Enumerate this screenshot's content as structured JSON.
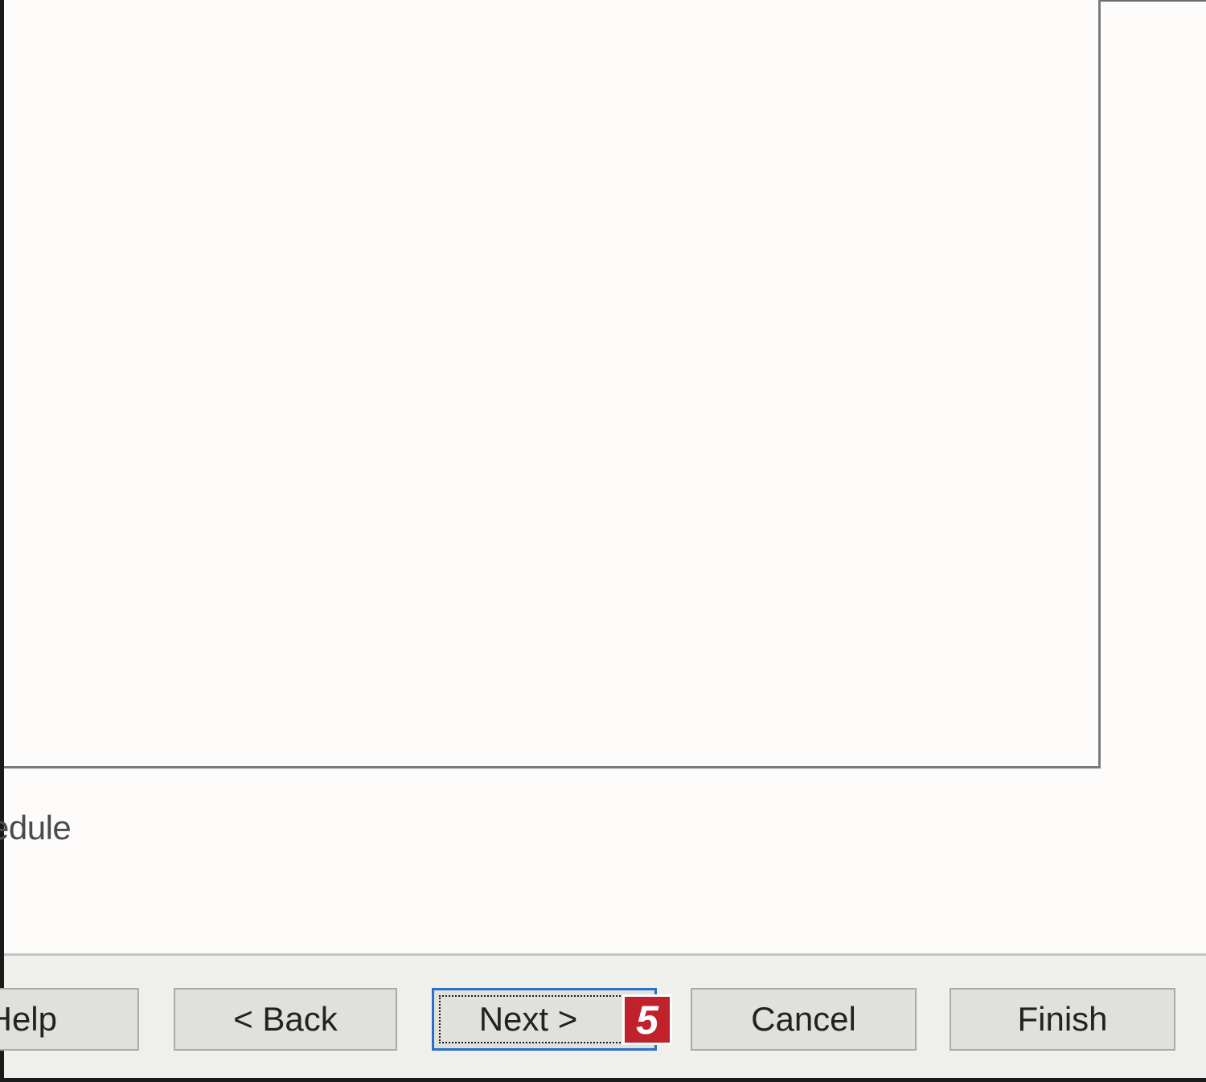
{
  "dialog": {
    "schedule_text": "edule"
  },
  "buttons": {
    "help_label": "Help",
    "back_label": "< Back",
    "next_label": "Next >",
    "cancel_label": "Cancel",
    "finish_label": "Finish"
  },
  "annotation": {
    "step_number": "5",
    "badge_color": "#c0212a"
  },
  "colors": {
    "focus_border": "#2a6fc8",
    "button_face": "#e0e0dd",
    "dialog_background": "#fdfcfb"
  }
}
